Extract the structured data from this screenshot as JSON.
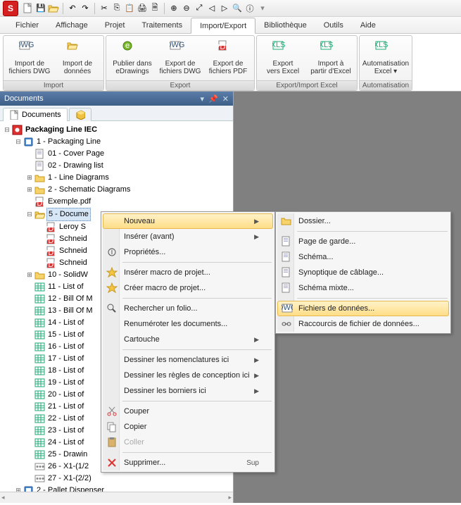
{
  "menubar": [
    "Fichier",
    "Affichage",
    "Projet",
    "Traitements",
    "Import/Export",
    "Bibliothèque",
    "Outils",
    "Aide"
  ],
  "active_menu": 4,
  "ribbon": {
    "groups": [
      {
        "title": "Import",
        "buttons": [
          {
            "label": "Import de\nfichiers DWG",
            "icon": "dwg-in"
          },
          {
            "label": "Import de\ndonnées",
            "icon": "data-in"
          }
        ]
      },
      {
        "title": "Export",
        "buttons": [
          {
            "label": "Publier dans\neDrawings",
            "icon": "edraw"
          },
          {
            "label": "Export de\nfichiers DWG",
            "icon": "dwg-out"
          },
          {
            "label": "Export de\nfichiers PDF",
            "icon": "pdf-out"
          }
        ]
      },
      {
        "title": "Export/Import Excel",
        "buttons": [
          {
            "label": "Export\nvers Excel",
            "icon": "xls-out"
          },
          {
            "label": "Import à\npartir d'Excel",
            "icon": "xls-in"
          }
        ]
      },
      {
        "title": "Automatisation",
        "buttons": [
          {
            "label": "Automatisation\nExcel ▾",
            "icon": "xls-auto"
          }
        ]
      }
    ]
  },
  "panel": {
    "title": "Documents",
    "tabs": [
      {
        "label": "Documents",
        "icon": "doc"
      },
      {
        "label": "",
        "icon": "cube"
      }
    ]
  },
  "tree": {
    "root": {
      "label": "Packaging Line IEC",
      "icon": "pkg",
      "expanded": true,
      "children": [
        {
          "label": "1 - Packaging Line",
          "icon": "book",
          "expanded": true,
          "children": [
            {
              "label": "01 - Cover Page",
              "icon": "sheet"
            },
            {
              "label": "02 - Drawing list",
              "icon": "sheet"
            },
            {
              "label": "1 - Line Diagrams",
              "icon": "folder",
              "expander": "+"
            },
            {
              "label": "2 - Schematic Diagrams",
              "icon": "folder",
              "expander": "+"
            },
            {
              "label": "Exemple.pdf",
              "icon": "pdf"
            },
            {
              "label": "5 - Docume",
              "icon": "folder-open",
              "expander": "-",
              "selected": true,
              "children": [
                {
                  "label": "Leroy S",
                  "icon": "pdf"
                },
                {
                  "label": "Schneid",
                  "icon": "pdf"
                },
                {
                  "label": "Schneid",
                  "icon": "pdf"
                },
                {
                  "label": "Schneid",
                  "icon": "pdf"
                }
              ]
            },
            {
              "label": "10 - SolidW",
              "icon": "folder",
              "expander": "+"
            },
            {
              "label": "11 - List of",
              "icon": "grid"
            },
            {
              "label": "12 - Bill Of M",
              "icon": "grid"
            },
            {
              "label": "13 - Bill Of M",
              "icon": "grid"
            },
            {
              "label": "14 - List of",
              "icon": "grid"
            },
            {
              "label": "15 - List of",
              "icon": "grid"
            },
            {
              "label": "16 - List of",
              "icon": "grid"
            },
            {
              "label": "17 - List of",
              "icon": "grid"
            },
            {
              "label": "18 - List of",
              "icon": "grid"
            },
            {
              "label": "19 - List of",
              "icon": "grid"
            },
            {
              "label": "20 - List of",
              "icon": "grid"
            },
            {
              "label": "21 - List of",
              "icon": "grid"
            },
            {
              "label": "22 - List of",
              "icon": "grid"
            },
            {
              "label": "23 - List of",
              "icon": "grid"
            },
            {
              "label": "24 - List of",
              "icon": "grid"
            },
            {
              "label": "25 - Drawin",
              "icon": "grid"
            },
            {
              "label": "26 - X1-(1/2",
              "icon": "term"
            },
            {
              "label": "27 - X1-(2/2)",
              "icon": "term"
            }
          ]
        },
        {
          "label": "2 - Pallet Dispenser",
          "icon": "book",
          "expander": "+"
        }
      ]
    }
  },
  "ctx_main": [
    {
      "label": "Nouveau",
      "icon": "",
      "sub": true,
      "hover": true
    },
    {
      "label": "Insérer (avant)",
      "icon": "",
      "sub": true
    },
    {
      "label": "Propriétés...",
      "icon": "props"
    },
    {
      "sep": true
    },
    {
      "label": "Insérer macro de projet...",
      "icon": "star"
    },
    {
      "label": "Créer macro de projet...",
      "icon": "star"
    },
    {
      "sep": true
    },
    {
      "label": "Rechercher un folio...",
      "icon": "search"
    },
    {
      "label": "Renuméroter les documents...",
      "icon": ""
    },
    {
      "label": "Cartouche",
      "icon": "",
      "sub": true
    },
    {
      "sep": true
    },
    {
      "label": "Dessiner les nomenclatures ici",
      "icon": "",
      "sub": true
    },
    {
      "label": "Dessiner les règles de conception ici",
      "icon": "",
      "sub": true
    },
    {
      "label": "Dessiner les borniers ici",
      "icon": "",
      "sub": true
    },
    {
      "sep": true
    },
    {
      "label": "Couper",
      "icon": "cut"
    },
    {
      "label": "Copier",
      "icon": "copy"
    },
    {
      "label": "Coller",
      "icon": "paste",
      "disabled": true
    },
    {
      "sep": true
    },
    {
      "label": "Supprimer...",
      "icon": "del",
      "shortcut": "Sup"
    }
  ],
  "ctx_sub": [
    {
      "label": "Dossier...",
      "icon": "folder"
    },
    {
      "sep": true
    },
    {
      "label": "Page de garde...",
      "icon": "sheet"
    },
    {
      "label": "Schéma...",
      "icon": "sheet"
    },
    {
      "label": "Synoptique de câblage...",
      "icon": "sheet"
    },
    {
      "label": "Schéma mixte...",
      "icon": "sheet"
    },
    {
      "sep": true
    },
    {
      "label": "Fichiers de données...",
      "icon": "dwg",
      "hover": true
    },
    {
      "label": "Raccourcis de fichier de données...",
      "icon": "link"
    }
  ]
}
